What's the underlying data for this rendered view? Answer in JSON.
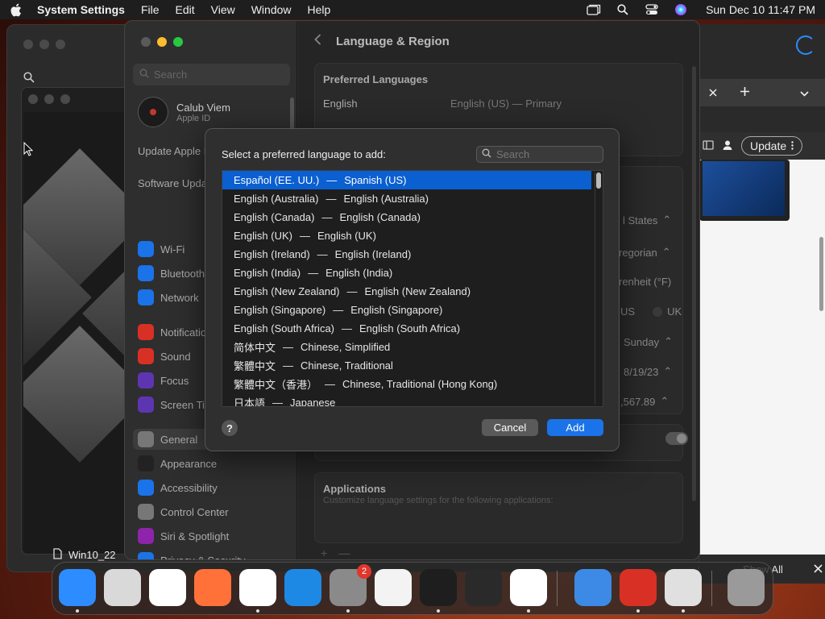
{
  "menubar": {
    "app_name": "System Settings",
    "items": [
      "File",
      "Edit",
      "View",
      "Window",
      "Help"
    ],
    "clock": "Sun Dec 10  11:47 PM"
  },
  "background_left": {
    "file_label": "Win10_22"
  },
  "background_right": {
    "update_label": "Update",
    "show_all_label": "Show All"
  },
  "settings": {
    "search_placeholder": "Search",
    "account_name": "Calub Viem",
    "account_sub": "Apple ID",
    "notice_update": "Update Apple ID Settings",
    "notice_software": "Software Update Available",
    "sidebar_items": [
      {
        "label": "Wi-Fi",
        "icon": "wifi-icon",
        "color": "#1a73e8"
      },
      {
        "label": "Bluetooth",
        "icon": "bluetooth-icon",
        "color": "#1a73e8"
      },
      {
        "label": "Network",
        "icon": "globe-icon",
        "color": "#1a73e8"
      },
      {
        "label": "Notifications",
        "icon": "bell-icon",
        "color": "#d93025"
      },
      {
        "label": "Sound",
        "icon": "speaker-icon",
        "color": "#d93025"
      },
      {
        "label": "Focus",
        "icon": "moon-icon",
        "color": "#5e35b1"
      },
      {
        "label": "Screen Time",
        "icon": "hourglass-icon",
        "color": "#5e35b1"
      },
      {
        "label": "General",
        "icon": "gear-icon",
        "color": "#777777"
      },
      {
        "label": "Appearance",
        "icon": "appearance-icon",
        "color": "#222222"
      },
      {
        "label": "Accessibility",
        "icon": "accessibility-icon",
        "color": "#1a73e8"
      },
      {
        "label": "Control Center",
        "icon": "control-center-icon",
        "color": "#777777"
      },
      {
        "label": "Siri & Spotlight",
        "icon": "siri-icon",
        "color": "#8e24aa"
      },
      {
        "label": "Privacy & Security",
        "icon": "hand-icon",
        "color": "#1a73e8"
      }
    ],
    "detail_title": "Language & Region",
    "preferred_title": "Preferred Languages",
    "pref_lang": "English",
    "pref_lang_detail": "English (US) — Primary",
    "region_value": "l States",
    "calendar_value": "regorian",
    "temperature_value": "renheit (°F)",
    "measurement_us": "US",
    "measurement_uk": "UK",
    "first_day_value": "Sunday",
    "date_format_value": "8/19/23",
    "number_format_value": ",567.89",
    "applications_title": "Applications",
    "applications_sub": "Customize language settings for the following applications:",
    "pm_buttons": [
      "+",
      "—"
    ]
  },
  "dialog": {
    "prompt": "Select a preferred language to add:",
    "search_placeholder": "Search",
    "languages": [
      {
        "native": "Español (EE. UU.)",
        "english": "Spanish (US)",
        "selected": true
      },
      {
        "native": "English (Australia)",
        "english": "English (Australia)"
      },
      {
        "native": "English (Canada)",
        "english": "English (Canada)"
      },
      {
        "native": "English (UK)",
        "english": "English (UK)"
      },
      {
        "native": "English (Ireland)",
        "english": "English (Ireland)"
      },
      {
        "native": "English (India)",
        "english": "English (India)"
      },
      {
        "native": "English (New Zealand)",
        "english": "English (New Zealand)"
      },
      {
        "native": "English (Singapore)",
        "english": "English (Singapore)"
      },
      {
        "native": "English (South Africa)",
        "english": "English (South Africa)"
      },
      {
        "native": "简体中文",
        "english": "Chinese, Simplified"
      },
      {
        "native": "繁體中文",
        "english": "Chinese, Traditional"
      },
      {
        "native": "繁體中文（香港）",
        "english": "Chinese, Traditional (Hong Kong)"
      },
      {
        "native": "日本語",
        "english": "Japanese"
      }
    ],
    "separator": "—",
    "help_label": "?",
    "cancel_label": "Cancel",
    "add_label": "Add"
  },
  "dock": {
    "apps": [
      {
        "name": "finder",
        "color": "#2d8cff",
        "running": true
      },
      {
        "name": "launchpad",
        "color": "#d9d9d9",
        "running": false
      },
      {
        "name": "safari",
        "color": "#ffffff",
        "running": false
      },
      {
        "name": "firefox",
        "color": "#ff7139",
        "running": false
      },
      {
        "name": "chrome",
        "color": "#ffffff",
        "running": true
      },
      {
        "name": "app-store",
        "color": "#1e88e5",
        "running": false
      },
      {
        "name": "system-settings",
        "color": "#8a8a8a",
        "running": true,
        "badge": "2"
      },
      {
        "name": "textedit",
        "color": "#f3f3f3",
        "running": false
      },
      {
        "name": "terminal",
        "color": "#1e1e1e",
        "running": true
      },
      {
        "name": "garageband",
        "color": "#2a2a2a",
        "running": false
      },
      {
        "name": "vscode",
        "color": "#ffffff",
        "running": true
      },
      {
        "name": "weather",
        "color": "#3d8ae6",
        "running": false
      },
      {
        "name": "compass",
        "color": "#d93025",
        "running": true
      },
      {
        "name": "disk-utility",
        "color": "#e0e0e0",
        "running": true
      },
      {
        "name": "trash",
        "color": "#9a9a9a",
        "running": false
      }
    ]
  }
}
